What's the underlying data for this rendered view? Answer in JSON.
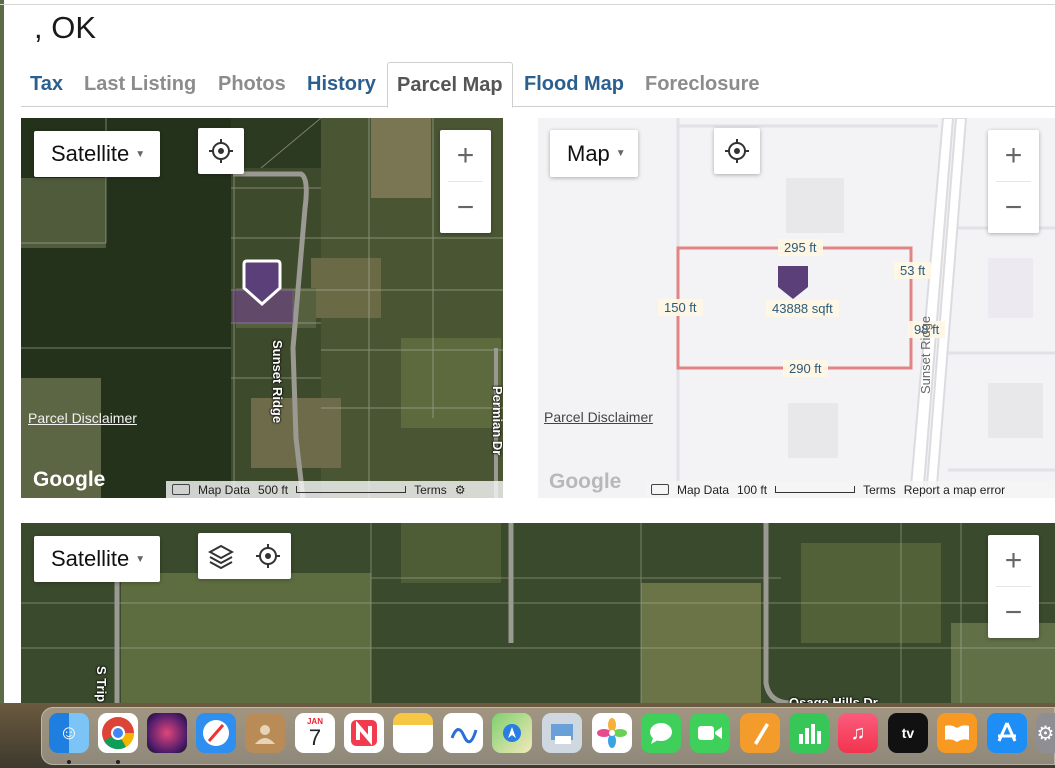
{
  "page_title": ", OK",
  "tabs": [
    {
      "label": "Tax",
      "style": "blue"
    },
    {
      "label": "Last Listing",
      "style": "gray"
    },
    {
      "label": "Photos",
      "style": "gray"
    },
    {
      "label": "History",
      "style": "blue"
    },
    {
      "label": "Parcel Map",
      "style": "active"
    },
    {
      "label": "Flood Map",
      "style": "blue"
    },
    {
      "label": "Foreclosure",
      "style": "gray"
    }
  ],
  "satellite_map": {
    "map_type": "Satellite",
    "zoom_in": "+",
    "zoom_out": "−",
    "disclaimer": "Parcel Disclaimer",
    "google": "Google",
    "map_data": "Map Data",
    "scale": "500 ft",
    "terms": "Terms",
    "roads": {
      "sunset": "Sunset Ridge",
      "permian": "Permian Dr"
    }
  },
  "road_map": {
    "map_type": "Map",
    "zoom_in": "+",
    "zoom_out": "−",
    "disclaimer": "Parcel Disclaimer",
    "google": "Google",
    "map_data": "Map Data",
    "scale": "100 ft",
    "terms": "Terms",
    "report": "Report a map error",
    "road": "Sunset Ridge",
    "dimensions": {
      "top": "295 ft",
      "left": "150 ft",
      "area": "43888 sqft",
      "right_top": "53 ft",
      "right_bottom": "98 ft",
      "bottom": "290 ft"
    }
  },
  "lower_map": {
    "map_type": "Satellite",
    "zoom_in": "+",
    "zoom_out": "−",
    "roads": {
      "s_trip": "S Trip",
      "osage": "Osage Hills Dr"
    }
  },
  "dock": {
    "calendar_month": "JAN",
    "calendar_day": "7",
    "tv_label": "tv",
    "apps": [
      "finder-icon",
      "chrome-icon",
      "siri-icon",
      "safari-icon",
      "contacts-icon",
      "calendar-icon",
      "news-icon",
      "notes-icon",
      "freeform-icon",
      "maps-icon",
      "preview-icon",
      "photos-icon",
      "messages-icon",
      "facetime-icon",
      "pages-icon",
      "numbers-icon",
      "music-icon",
      "apple-tv-icon",
      "books-icon",
      "app-store-icon",
      "system-settings-icon"
    ]
  },
  "colors": {
    "tab_blue": "#2b5f8f",
    "tab_gray": "#8c8c8c",
    "parcel_red": "#e07b7b",
    "marker_purple": "#5b3f78"
  }
}
